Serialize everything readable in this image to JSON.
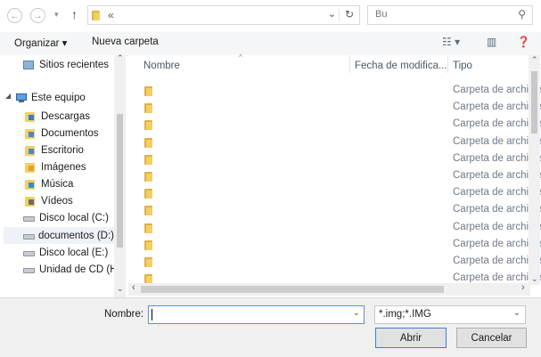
{
  "address": {
    "crumb": "«",
    "search_placeholder": "Bu"
  },
  "toolbar": {
    "organize_label": "Organizar ▾",
    "new_folder_label": "Nueva carpeta"
  },
  "nav": {
    "items": [
      {
        "label": "Sitios recientes",
        "icon": "recent-places-icon"
      },
      {
        "label": "Este equipo",
        "icon": "computer-icon"
      },
      {
        "label": "Descargas",
        "icon": "downloads-icon"
      },
      {
        "label": "Documentos",
        "icon": "documents-icon"
      },
      {
        "label": "Escritorio",
        "icon": "desktop-icon"
      },
      {
        "label": "Imágenes",
        "icon": "pictures-icon"
      },
      {
        "label": "Música",
        "icon": "music-icon"
      },
      {
        "label": "Vídeos",
        "icon": "videos-icon"
      },
      {
        "label": "Disco local (C:)",
        "icon": "drive-icon"
      },
      {
        "label": "documentos (D:)",
        "icon": "drive-icon"
      },
      {
        "label": "Disco local (E:)",
        "icon": "drive-icon"
      },
      {
        "label": "Unidad de CD (H",
        "icon": "cd-drive-icon"
      }
    ]
  },
  "list": {
    "columns": {
      "name": "Nombre",
      "date": "Fecha de modifica...",
      "type": "Tipo"
    },
    "row_type": "Carpeta de archivos",
    "rows": 12
  },
  "bottom": {
    "filename_label": "Nombre:",
    "filename_value": "",
    "filter_value": "*.img;*.IMG",
    "open_label": "Abrir",
    "cancel_label": "Cancelar"
  },
  "colors": {
    "accent": "#3c7fd1",
    "folder": "#f2cf67"
  }
}
